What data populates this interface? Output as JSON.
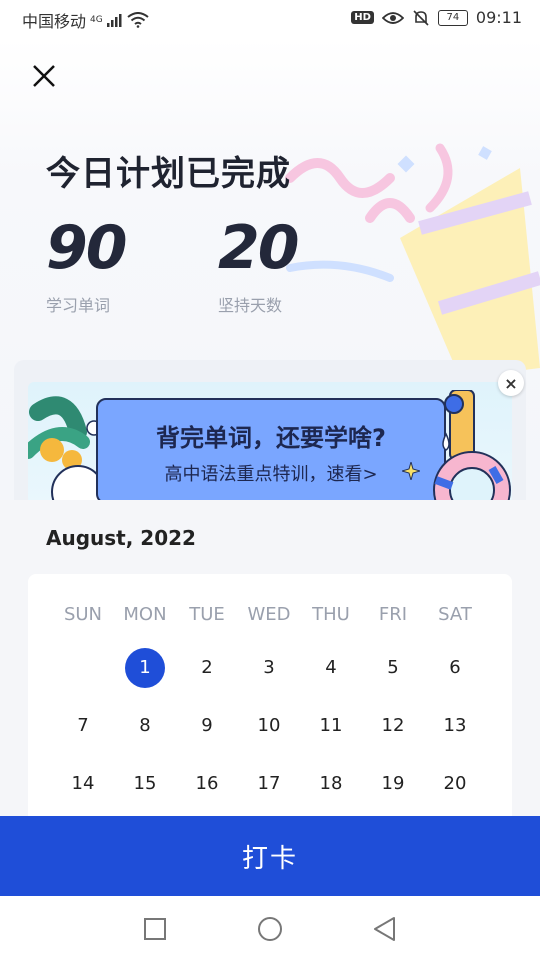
{
  "status": {
    "carrier": "中国移动",
    "network": "4G",
    "hd": "HD",
    "battery": "74",
    "time": "09:11"
  },
  "header": {
    "title": "今日计划已完成",
    "stats": [
      {
        "value": "90",
        "label": "学习单词"
      },
      {
        "value": "20",
        "label": "坚持天数"
      }
    ]
  },
  "banner": {
    "title": "背完单词，还要学啥?",
    "subtitle": "高中语法重点特训，速看>",
    "close": "×"
  },
  "calendar": {
    "month": "August, 2022",
    "weekdays": [
      "SUN",
      "MON",
      "TUE",
      "WED",
      "THU",
      "FRI",
      "SAT"
    ],
    "weeks": [
      [
        "",
        "1",
        "2",
        "3",
        "4",
        "5",
        "6"
      ],
      [
        "7",
        "8",
        "9",
        "10",
        "11",
        "12",
        "13"
      ],
      [
        "14",
        "15",
        "16",
        "17",
        "18",
        "19",
        "20"
      ]
    ],
    "selected_day": "1"
  },
  "action": {
    "checkin_label": "打卡"
  },
  "colors": {
    "accent": "#1f4ed8",
    "banner_card": "#7aa6ff"
  }
}
